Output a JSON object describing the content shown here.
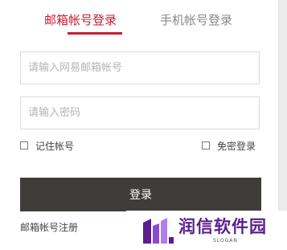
{
  "tabs": [
    {
      "label": "邮箱帐号登录",
      "active": true
    },
    {
      "label": "手机帐号登录",
      "active": false
    }
  ],
  "email": {
    "value": "",
    "placeholder": "请输入网易邮箱帐号"
  },
  "password": {
    "value": "",
    "placeholder": "请输入密码"
  },
  "remember": {
    "label": "记住帐号",
    "checked": false
  },
  "autologin": {
    "label": "免密登录",
    "checked": false
  },
  "login_button": {
    "label": "登录"
  },
  "register_link": {
    "label": "邮箱帐号注册"
  },
  "watermark": {
    "title": "润信软件园",
    "slogan": "SLOGAN"
  },
  "colors": {
    "accent": "#c81d31",
    "button": "#3e3d3a",
    "watermark": "#5a1f8e"
  }
}
